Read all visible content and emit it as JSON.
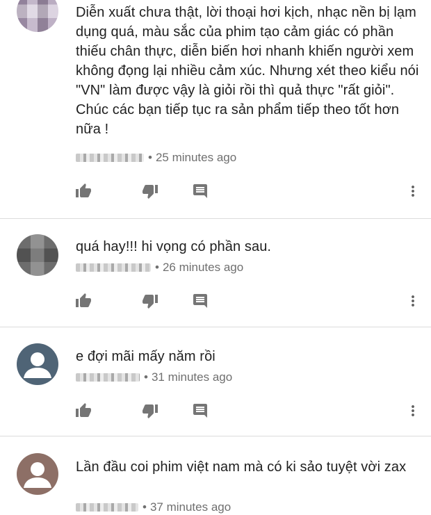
{
  "comments": [
    {
      "text": "Diễn xuất chưa thật, lời thoại hơi kịch, nhạc nền bị lạm dụng quá, màu sắc của phim tạo cảm giác có phần thiếu chân thực, diễn biến hơi nhanh khiến người xem không đọng lại nhiều cảm xúc. Nhưng xét theo kiểu nói \"VN\" làm được vậy là giỏi rồi thì quả thực \"rất giỏi\". Chúc các bạn tiếp tục ra sản phẩm tiếp theo tốt hơn nữa !",
      "time": "25 minutes ago",
      "avatar": "pixelated"
    },
    {
      "text": "quá hay!!! hi vọng có phần sau.",
      "time": "26 minutes ago",
      "avatar": "pixelated"
    },
    {
      "text": "e đợi mãi mấy năm rồi",
      "time": "31 minutes ago",
      "avatar": "default-person-icon"
    },
    {
      "text": "Lần đầu coi phim việt nam mà có ki sảo tuyệt vời zax",
      "time": "37 minutes ago",
      "avatar": "default-person-icon"
    }
  ],
  "separator": "•",
  "icons": {
    "like": "thumb-up-icon",
    "dislike": "thumb-down-icon",
    "reply": "comment-icon",
    "more": "more-vertical-icon"
  },
  "colors": {
    "icon": "#757575",
    "avatar_blue": "#4f6476",
    "avatar_brown": "#8d6f66",
    "divider": "#dcdcdc"
  }
}
